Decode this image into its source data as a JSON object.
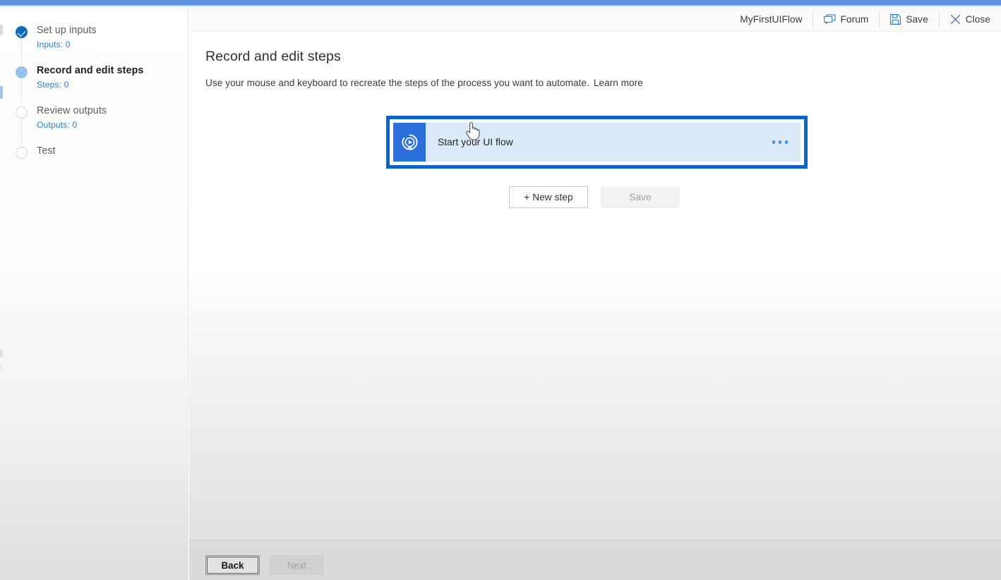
{
  "theme": {
    "accent_bar": "#5b91e0",
    "highlight_border": "#0b64c8",
    "card_bg": "#dbeaf9",
    "card_icon_bg": "#2a6fdb",
    "step_done": "#0f6cbd",
    "step_current": "#97c2f0",
    "link_blue": "#2d7cc6"
  },
  "header": {
    "flow_name": "MyFirstUIFlow",
    "forum_label": "Forum",
    "forum_icon": "chat-bubble-icon",
    "save_label": "Save",
    "save_icon": "floppy-disk-icon",
    "close_label": "Close",
    "close_icon": "close-x-icon"
  },
  "sidebar": {
    "steps": [
      {
        "title": "Set up inputs",
        "sub": "Inputs: 0",
        "state": "done",
        "marker_icon": "check-circle-icon"
      },
      {
        "title": "Record and edit steps",
        "sub": "Steps: 0",
        "state": "current",
        "marker_icon": "filled-circle-icon"
      },
      {
        "title": "Review outputs",
        "sub": "Outputs: 0",
        "state": "pending",
        "marker_icon": "empty-circle-icon"
      },
      {
        "title": "Test",
        "sub": "",
        "state": "pending",
        "marker_icon": "empty-circle-icon"
      }
    ]
  },
  "main": {
    "title": "Record and edit steps",
    "description": "Use your mouse and keyboard to recreate the steps of the process you want to automate.",
    "learn_more": "Learn more",
    "step_card": {
      "label": "Start your UI flow",
      "icon": "record-play-circle-icon",
      "more_icon": "ellipsis-horizontal-icon"
    },
    "new_step_label": "+ New step",
    "save_label": "Save"
  },
  "footer": {
    "back_label": "Back",
    "next_label": "Next"
  },
  "cursor": {
    "icon": "hand-pointer-cursor"
  }
}
